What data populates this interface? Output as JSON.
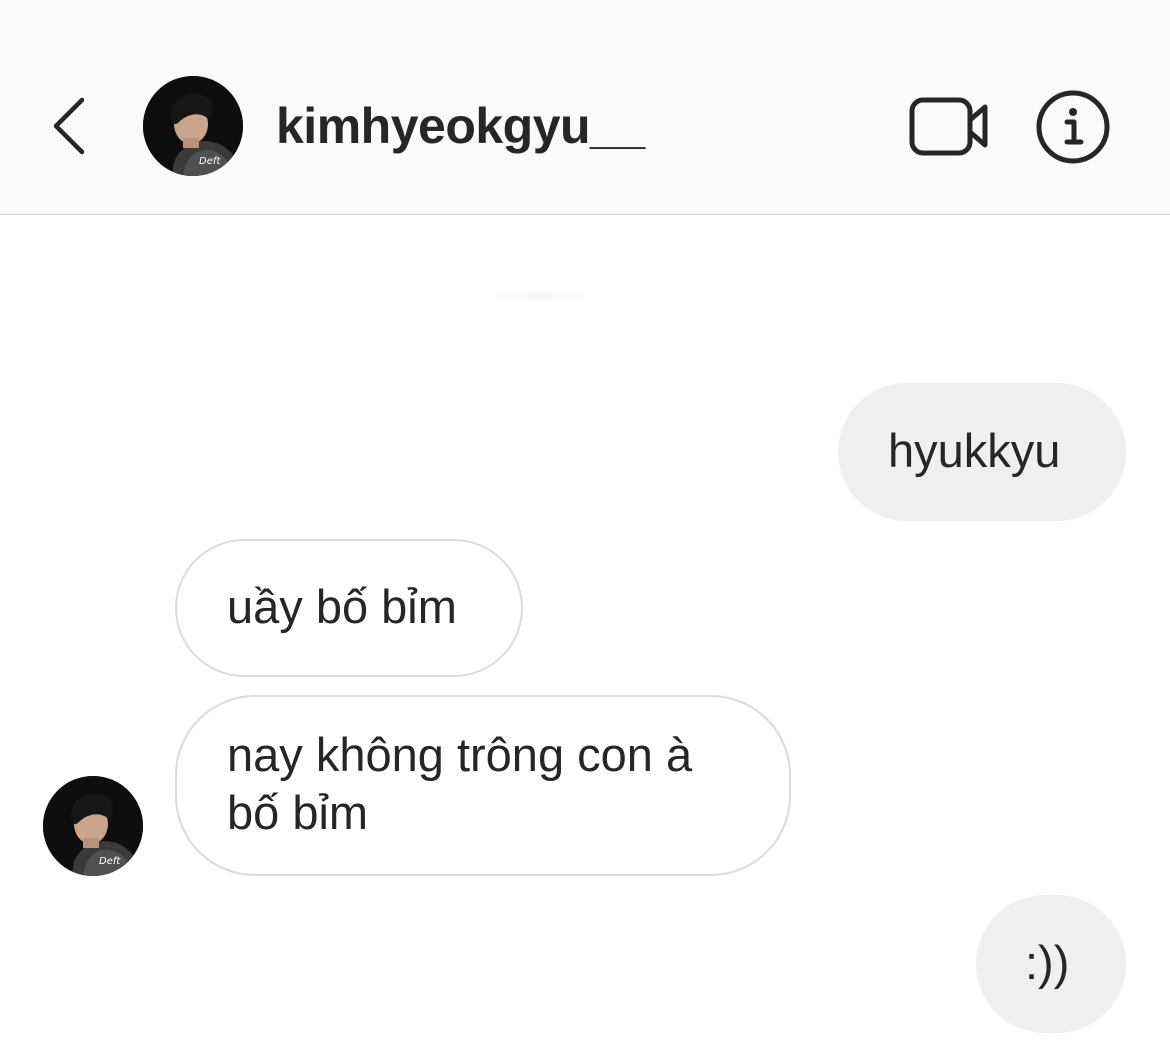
{
  "header": {
    "username": "kimhyeokgyu__",
    "back_icon": "chevron-left-icon",
    "video_icon": "video-camera-icon",
    "info_icon": "info-icon",
    "avatar_caption": "Deft"
  },
  "messages": [
    {
      "direction": "outgoing",
      "text": "hyukkyu"
    },
    {
      "direction": "incoming",
      "text": "uầy bố bỉm"
    },
    {
      "direction": "incoming",
      "lines": [
        "nay không trông con à",
        "bố bỉm"
      ]
    },
    {
      "direction": "outgoing",
      "text": ":))"
    }
  ],
  "colors": {
    "header_bg": "#fafafa",
    "outgoing_bubble": "#efefef",
    "incoming_border": "#dbdbdb",
    "text": "#262626"
  }
}
